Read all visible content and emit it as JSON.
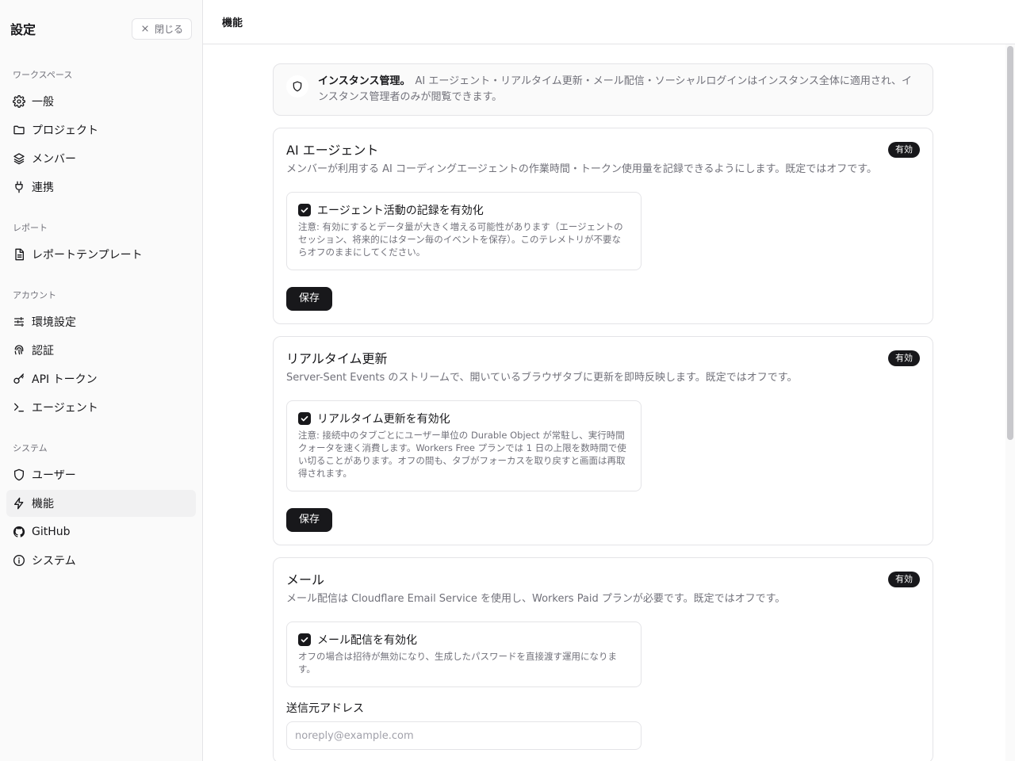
{
  "sidebar": {
    "title": "設定",
    "close_label": "閉じる",
    "sections": [
      {
        "label": "ワークスペース",
        "items": [
          {
            "label": "一般",
            "icon": "gear-icon"
          },
          {
            "label": "プロジェクト",
            "icon": "folder-icon"
          },
          {
            "label": "メンバー",
            "icon": "layers-icon"
          },
          {
            "label": "連携",
            "icon": "plug-icon"
          }
        ]
      },
      {
        "label": "レポート",
        "items": [
          {
            "label": "レポートテンプレート",
            "icon": "document-icon"
          }
        ]
      },
      {
        "label": "アカウント",
        "items": [
          {
            "label": "環境設定",
            "icon": "sliders-icon"
          },
          {
            "label": "認証",
            "icon": "fingerprint-icon"
          },
          {
            "label": "API トークン",
            "icon": "key-icon"
          },
          {
            "label": "エージェント",
            "icon": "terminal-icon"
          }
        ]
      },
      {
        "label": "システム",
        "items": [
          {
            "label": "ユーザー",
            "icon": "shield-icon"
          },
          {
            "label": "機能",
            "icon": "zap-icon",
            "active": true
          },
          {
            "label": "GitHub",
            "icon": "github-icon"
          },
          {
            "label": "システム",
            "icon": "info-icon"
          }
        ]
      }
    ]
  },
  "topbar": {
    "title": "機能"
  },
  "notice": {
    "title": "インスタンス管理。",
    "text": "AI エージェント・リアルタイム更新・メール配信・ソーシャルログインはインスタンス全体に適用され、インスタンス管理者のみが閲覧できます。"
  },
  "cards": {
    "ai_agent": {
      "title": "AI エージェント",
      "badge": "有効",
      "description": "メンバーが利用する AI コーディングエージェントの作業時間・トークン使用量を記録できるようにします。既定ではオフです。",
      "option_label": "エージェント活動の記録を有効化",
      "option_checked": true,
      "option_note": "注意: 有効にするとデータ量が大きく増える可能性があります（エージェントのセッション、将来的にはターン毎のイベントを保存）。このテレメトリが不要ならオフのままにしてください。",
      "save_label": "保存"
    },
    "realtime": {
      "title": "リアルタイム更新",
      "badge": "有効",
      "description": "Server-Sent Events のストリームで、開いているブラウザタブに更新を即時反映します。既定ではオフです。",
      "option_label": "リアルタイム更新を有効化",
      "option_checked": true,
      "option_note": "注意: 接続中のタブごとにユーザー単位の Durable Object が常駐し、実行時間クォータを速く消費します。Workers Free プランでは 1 日の上限を数時間で使い切ることがあります。オフの間も、タブがフォーカスを取り戻すと画面は再取得されます。",
      "save_label": "保存"
    },
    "mail": {
      "title": "メール",
      "badge": "有効",
      "description": "メール配信は Cloudflare Email Service を使用し、Workers Paid プランが必要です。既定ではオフです。",
      "option_label": "メール配信を有効化",
      "option_checked": true,
      "option_note": "オフの場合は招待が無効になり、生成したパスワードを直接渡す運用になります。",
      "sender_label": "送信元アドレス",
      "sender_placeholder": "noreply@example.com"
    }
  }
}
